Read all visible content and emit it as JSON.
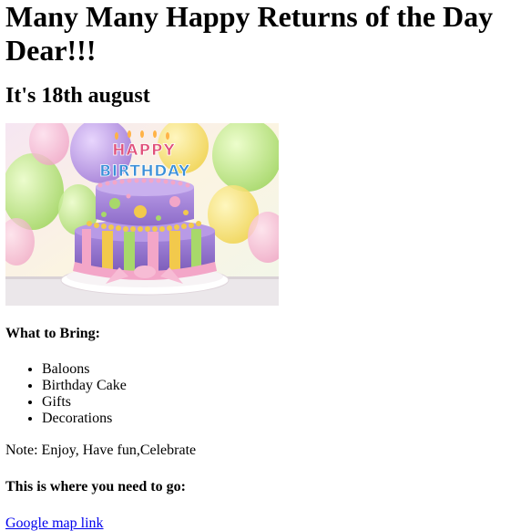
{
  "header": {
    "title": "Many Many Happy Returns of the Day Dear!!!",
    "date_heading": "It's 18th august"
  },
  "image": {
    "icon": "birthday-cake-image",
    "cake_text_top": "HAPPY",
    "cake_text_bottom": "BIRTHDAY",
    "colors": {
      "cake_purple": "#9b7fd4",
      "ribbon_pink": "#f3a6c8",
      "ball_yellow": "#f2c94c",
      "stripe_green": "#a8d86a"
    }
  },
  "bring": {
    "heading": "What to Bring:",
    "items": [
      "Baloons",
      "Birthday Cake",
      "Gifts",
      "Decorations"
    ]
  },
  "note": "Note: Enjoy, Have fun,Celebrate",
  "location": {
    "heading": "This is where you need to go:",
    "link_text": "Google map link"
  },
  "colors": {
    "link": "#0000ee"
  }
}
